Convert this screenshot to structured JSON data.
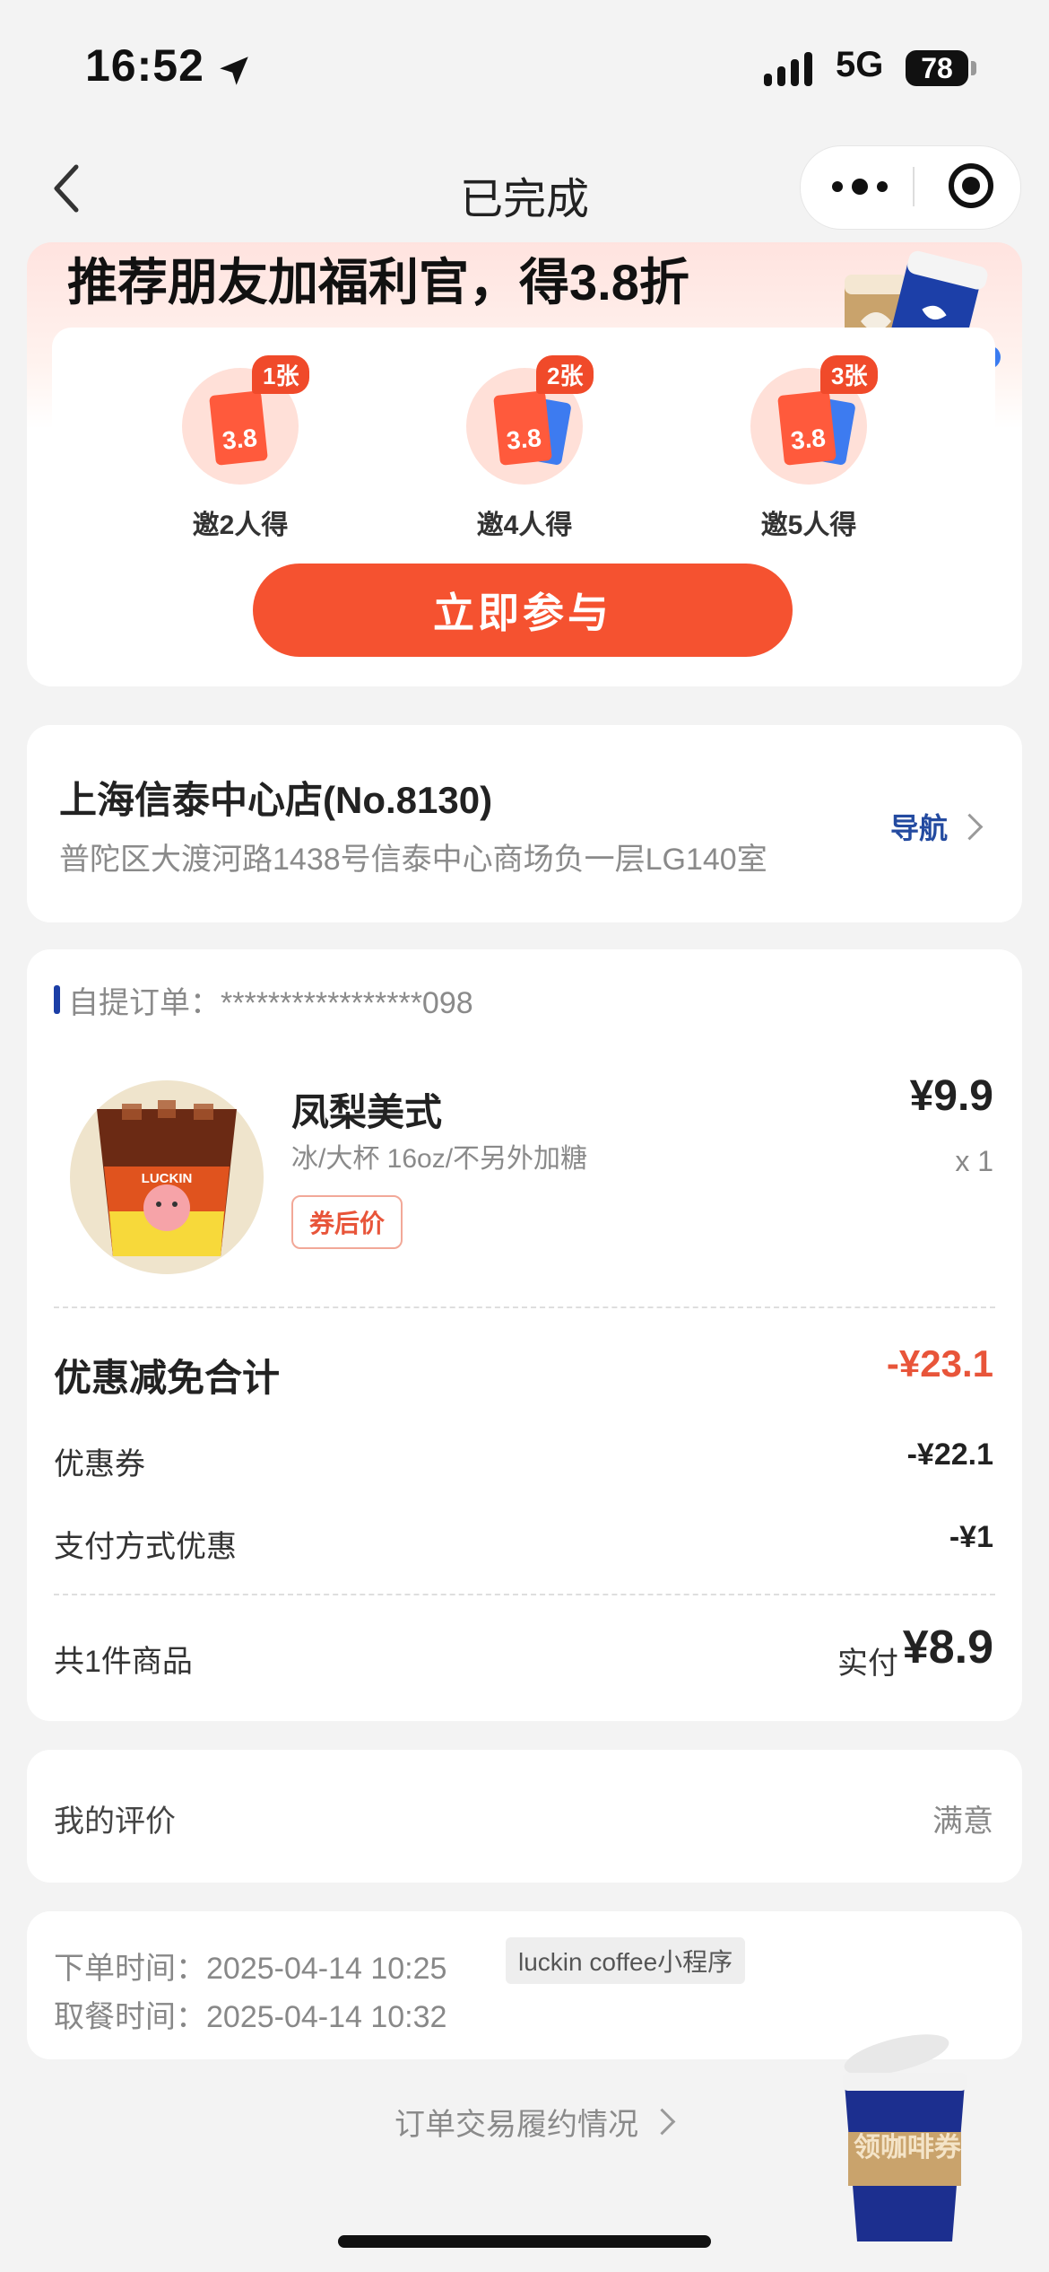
{
  "status_bar": {
    "time": "16:52",
    "network": "5G",
    "battery": "78"
  },
  "nav": {
    "title": "已完成"
  },
  "promo": {
    "title": "推荐朋友加福利官，得3.8折",
    "rewards": [
      {
        "badge": "1张",
        "ticket": "3.8",
        "label": "邀2人得"
      },
      {
        "badge": "2张",
        "ticket": "3.8",
        "label": "邀4人得"
      },
      {
        "badge": "3张",
        "ticket": "3.8",
        "label": "邀5人得"
      }
    ],
    "button": "立即参与"
  },
  "store": {
    "name": "上海信泰中心店(No.8130)",
    "address": "普陀区大渡河路1438号信泰中心商场负一层LG140室",
    "nav_label": "导航"
  },
  "order": {
    "label": "自提订单：",
    "number": "*****************098",
    "product": {
      "name": "凤梨美式",
      "spec": "冰/大杯 16oz/不另外加糖",
      "tag": "券后价",
      "price": "¥9.9",
      "qty": "x 1",
      "cup_text": "LUCKIN"
    },
    "discount_total_label": "优惠减免合计",
    "discount_total": "-¥23.1",
    "coupon_label": "优惠券",
    "coupon_value": "-¥22.1",
    "pay_label": "支付方式优惠",
    "pay_value": "-¥1",
    "count_label": "共1件商品",
    "paid_label": "实付",
    "paid_value": "¥8.9"
  },
  "review": {
    "label": "我的评价",
    "value": "满意"
  },
  "times": {
    "order_label": "下单时间：",
    "order_time": "2025-04-14 10:25",
    "source": "luckin coffee小程序",
    "pickup_label": "取餐时间：",
    "pickup_time": "2025-04-14 10:32"
  },
  "footer": {
    "link": "订单交易履约情况"
  },
  "coupon_float": {
    "text": "领咖啡券"
  },
  "colors": {
    "accent": "#f55230",
    "brand_blue": "#1b3ea6",
    "discount": "#e8553a"
  }
}
